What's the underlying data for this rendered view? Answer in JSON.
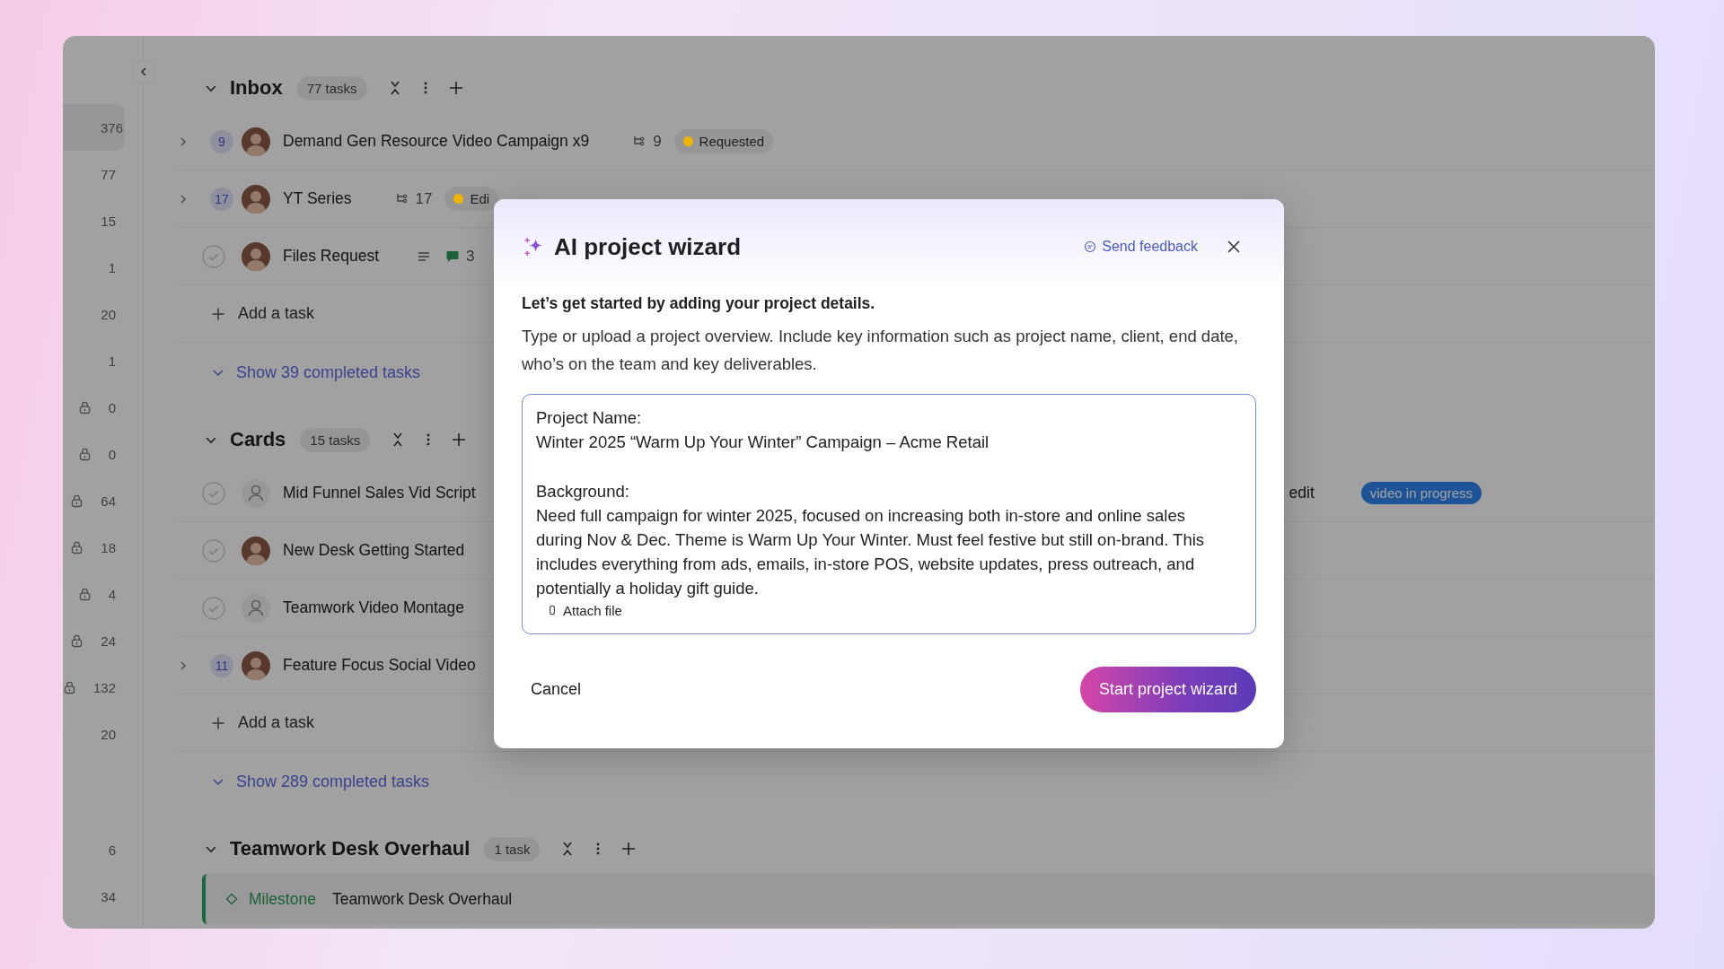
{
  "sidebar": {
    "counts": [
      {
        "value": "376",
        "locked": false,
        "selected": true
      },
      {
        "value": "77",
        "locked": false,
        "selected": false
      },
      {
        "value": "15",
        "locked": false,
        "selected": false
      },
      {
        "value": "1",
        "locked": false,
        "selected": false
      },
      {
        "value": "20",
        "locked": false,
        "selected": false
      },
      {
        "value": "1",
        "locked": false,
        "selected": false
      },
      {
        "value": "0",
        "locked": true,
        "selected": false
      },
      {
        "value": "0",
        "locked": true,
        "selected": false
      },
      {
        "value": "64",
        "locked": true,
        "selected": false
      },
      {
        "value": "18",
        "locked": true,
        "selected": false
      },
      {
        "value": "4",
        "locked": true,
        "selected": false
      },
      {
        "value": "24",
        "locked": true,
        "selected": false
      },
      {
        "value": "132",
        "locked": true,
        "selected": false
      },
      {
        "value": "20",
        "locked": false,
        "selected": false
      }
    ],
    "lower_counts": [
      {
        "value": "6",
        "locked": false,
        "selected": false
      },
      {
        "value": "34",
        "locked": false,
        "selected": false
      }
    ]
  },
  "sections": [
    {
      "title": "Inbox",
      "count": "77 tasks",
      "add_label": "Add a task",
      "completed_link": "Show 39 completed tasks",
      "tasks": [
        {
          "kind": "parent",
          "count": "9",
          "avatar_photo": true,
          "title": "Demand Gen Resource Video Campaign x9",
          "subtasks": "9",
          "status": {
            "label": "Requested",
            "color": "#f0b400"
          }
        },
        {
          "kind": "parent",
          "count": "17",
          "avatar_photo": true,
          "title": "YT Series",
          "subtasks": "17",
          "status": {
            "label": "Edi",
            "color": "#f0b400"
          }
        },
        {
          "kind": "task",
          "checked": false,
          "avatar_photo": true,
          "title": "Files Request",
          "description": true,
          "comments": "3"
        }
      ]
    },
    {
      "title": "Cards",
      "count": "15 tasks",
      "add_label": "Add a task",
      "completed_link": "Show 289 completed tasks",
      "tasks": [
        {
          "kind": "task",
          "checked": false,
          "avatar_photo": false,
          "title": "Mid Funnel Sales Vid Script",
          "extra": "edit",
          "tag": "video in progress"
        },
        {
          "kind": "task",
          "checked": false,
          "avatar_photo": true,
          "title": "New Desk Getting Started"
        },
        {
          "kind": "task",
          "checked": false,
          "avatar_photo": false,
          "title": "Teamwork Video Montage"
        },
        {
          "kind": "parent",
          "count": "11",
          "avatar_photo": true,
          "title": "Feature Focus Social Video"
        }
      ]
    },
    {
      "title": "Teamwork Desk Overhaul",
      "count": "1 task",
      "tasks": [
        {
          "kind": "milestone",
          "label": "Milestone",
          "title": "Teamwork Desk Overhaul"
        }
      ]
    }
  ],
  "modal": {
    "title": "AI project wizard",
    "feedback": "Send feedback",
    "intro": "Let’s get started by adding your project details.",
    "description": "Type or upload a project overview. Include key information such as project name, client, end date, who’s on the team and key deliverables.",
    "overview": "Project Name:\nWinter 2025 “Warm Up Your Winter” Campaign – Acme Retail\n\nBackground:\nNeed full campaign for winter 2025, focused on increasing both in-store and online sales during Nov & Dec. Theme is Warm Up Your Winter. Must feel festive but still on-brand. This includes everything from ads, emails, in-store POS, website updates, press outreach, and potentially a holiday gift guide.",
    "attach": "Attach file",
    "cancel": "Cancel",
    "submit": "Start project wizard"
  }
}
